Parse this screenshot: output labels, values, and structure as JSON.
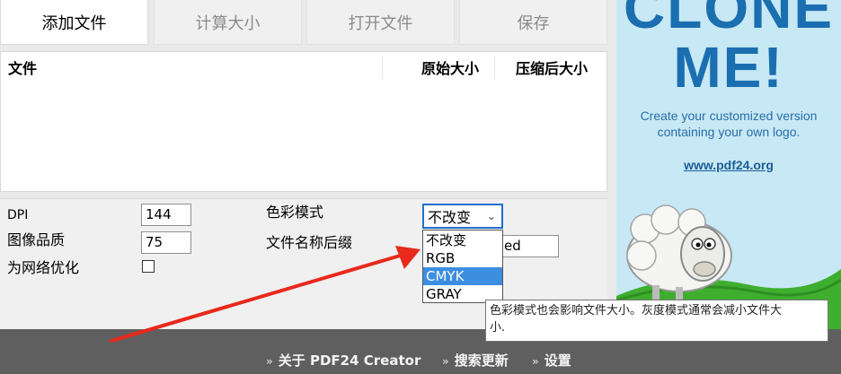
{
  "toolbar": {
    "add_files": "添加文件",
    "calc_size": "计算大小",
    "open_file": "打开文件",
    "save": "保存"
  },
  "file_list": {
    "col_file": "文件",
    "col_original_size": "原始大小",
    "col_compressed_size": "压缩后大小"
  },
  "options": {
    "dpi_label": "DPI",
    "dpi_value": "144",
    "quality_label": "图像品质",
    "quality_value": "75",
    "web_optimize_label": "为网络优化",
    "web_optimize_checked": false,
    "color_mode_label": "色彩模式",
    "color_mode_value": "不改变",
    "suffix_label": "文件名称后缀",
    "suffix_value": "ed"
  },
  "color_mode_options": [
    "不改变",
    "RGB",
    "CMYK",
    "GRAY"
  ],
  "color_mode_highlighted": "CMYK",
  "tooltip": {
    "line1": "色彩模式也会影响文件大小。灰度模式通常会减小文件大",
    "line2": "小."
  },
  "ad": {
    "headline1": "CLONE",
    "headline2": "ME!",
    "text_line1": "Create your customized version",
    "text_line2": "containing your own logo.",
    "link": "www.pdf24.org"
  },
  "footer": {
    "about": "关于 PDF24 Creator",
    "check_updates": "搜索更新",
    "settings": "设置"
  },
  "colors": {
    "accent": "#3c8ee0",
    "arrow": "#e8291c",
    "footer_bg": "#5f5f5f"
  }
}
